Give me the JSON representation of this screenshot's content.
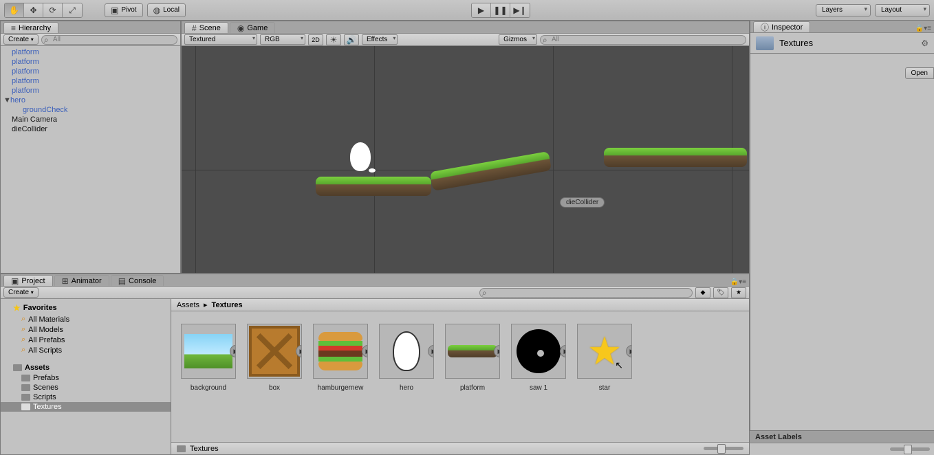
{
  "toolbar": {
    "pivot_label": "Pivot",
    "local_label": "Local",
    "layers_label": "Layers",
    "layout_label": "Layout"
  },
  "hierarchy": {
    "tab": "Hierarchy",
    "create": "Create",
    "search_placeholder": "All",
    "items": [
      {
        "label": "platform",
        "type": "prefab"
      },
      {
        "label": "platform",
        "type": "prefab"
      },
      {
        "label": "platform",
        "type": "prefab"
      },
      {
        "label": "platform",
        "type": "prefab"
      },
      {
        "label": "platform",
        "type": "prefab"
      },
      {
        "label": "hero",
        "type": "prefab",
        "expanded": true,
        "children": [
          {
            "label": "groundCheck"
          }
        ]
      },
      {
        "label": "Main Camera",
        "type": "object"
      },
      {
        "label": "dieCollider",
        "type": "object"
      }
    ]
  },
  "scene": {
    "tabs": {
      "scene": "Scene",
      "game": "Game"
    },
    "shading_dd": "Textured",
    "render_dd": "RGB",
    "mode_2d": "2D",
    "effects": "Effects",
    "gizmos": "Gizmos",
    "search_placeholder": "All",
    "overlay_label": "dieCollider"
  },
  "project": {
    "tabs": {
      "project": "Project",
      "animator": "Animator",
      "console": "Console"
    },
    "create": "Create",
    "breadcrumb": [
      "Assets",
      "Textures"
    ],
    "favorites_header": "Favorites",
    "favorites": [
      "All Materials",
      "All Models",
      "All Prefabs",
      "All Scripts"
    ],
    "assets_header": "Assets",
    "folders": [
      "Prefabs",
      "Scenes",
      "Scripts",
      "Textures"
    ],
    "selected_folder": "Textures",
    "assets": [
      {
        "name": "background"
      },
      {
        "name": "box"
      },
      {
        "name": "hamburgernew"
      },
      {
        "name": "hero"
      },
      {
        "name": "platform"
      },
      {
        "name": "saw 1"
      },
      {
        "name": "star"
      }
    ],
    "footer": "Textures"
  },
  "inspector": {
    "tab": "Inspector",
    "title": "Textures",
    "open": "Open",
    "asset_labels": "Asset Labels"
  }
}
